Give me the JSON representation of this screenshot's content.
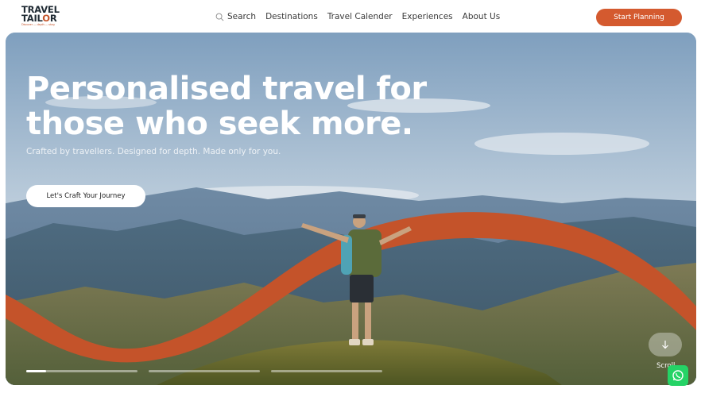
{
  "brand": {
    "line1": "TRAVEL",
    "line2a": "TAIL",
    "line2b": "O",
    "line2c": "R",
    "tagline": "Discover — depth — story"
  },
  "nav": {
    "search": "Search",
    "items": [
      "Destinations",
      "Travel Calender",
      "Experiences",
      "About Us"
    ]
  },
  "header": {
    "cta_label": "Start Planning"
  },
  "hero": {
    "title_line1": "Personalised travel for",
    "title_line2": "those who seek more.",
    "subtitle": "Crafted by travellers. Designed for depth. Made only for you.",
    "button_label": "Let's Craft Your Journey",
    "scroll_label": "Scroll",
    "slide_progress": [
      0.18,
      0,
      0
    ],
    "accent_color": "#d45a2f",
    "ribbon_color": "#c4532a"
  },
  "icons": {
    "search": "search-icon",
    "scroll": "arrow-down-icon",
    "chat": "whatsapp-icon"
  }
}
